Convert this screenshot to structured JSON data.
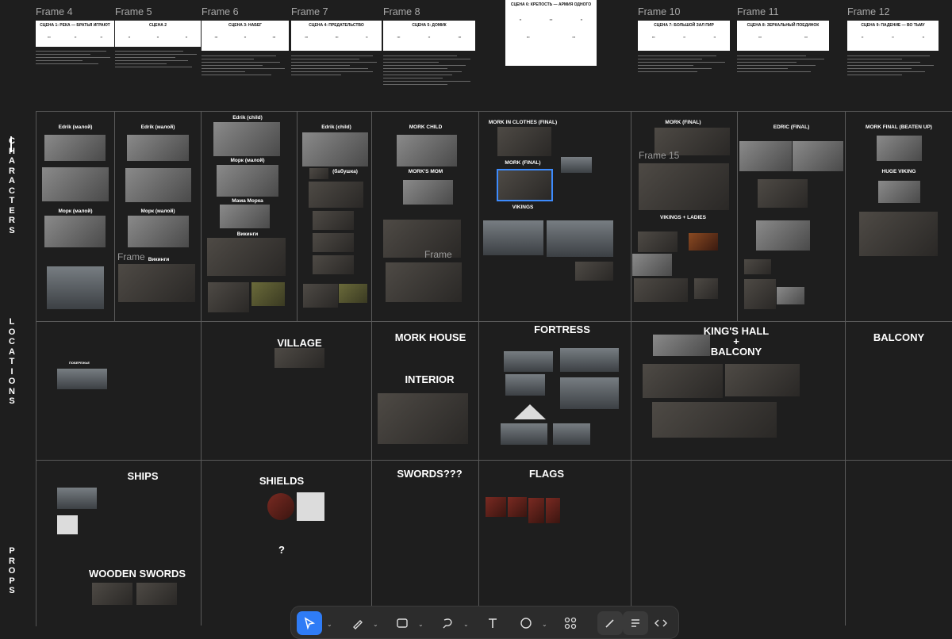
{
  "frames": {
    "frame4": "Frame 4",
    "frame5": "Frame 5",
    "frame6": "Frame 6",
    "frame7": "Frame 7",
    "frame8": "Frame 8",
    "frame10": "Frame 10",
    "frame11": "Frame 11",
    "frame12": "Frame 12",
    "frame15": "Frame 15",
    "frame_partial": "Frame"
  },
  "docs": {
    "d4": "СЦЕНА 1: РЕКА — БРАТЬЯ ИГРАЮТ",
    "d5": "СЦЕНА 2",
    "d6": "СЦЕНА 3: НАБЕГ",
    "d7": "СЦЕНА 4: ПРЕДАТЕЛЬСТВО",
    "d8": "СЦЕНА 5: ДОМИК",
    "d9": "СЦЕНА 6: КРЕПОСТЬ — АРМИЯ ОДНОГО",
    "d10": "СЦЕНА 7: БОЛЬШОЙ ЗАЛ ПИР",
    "d11": "СЦЕНА 8: ЗЕРКАЛЬНЫЙ ПОЕДИНОК",
    "d12": "СЦЕНА 9: ПАДЕНИЕ — ВО ТЬМУ"
  },
  "rows": {
    "characters": "CHARACTERS",
    "locations": "LOCATIONS",
    "props": "PROPS"
  },
  "characters": {
    "c1a": "Edrik (малой)",
    "c1b": "Морк (малой)",
    "c2a": "Edrik (малой)",
    "c2b": "Морк (малой)",
    "c2c": "Викинги",
    "c3a": "Edrik (child)",
    "c3b": "Морк (малой)",
    "c3c": "Мама Морка",
    "c3d": "Викинги",
    "c4a": "Edrik (child)",
    "c4b": "(бабушка)",
    "c5a": "MORK CHILD",
    "c5b": "MORK'S MOM",
    "c6a": "MORK IN CLOTHES (FINAL)",
    "c6b": "MORK (FINAL)",
    "c6c": "VIKINGS",
    "c7a": "MORK (FINAL)",
    "c7b": "VIKINGS + LADIES",
    "c8a": "EDRIC (FINAL)",
    "c9a": "MORK FINAL (BEATEN UP)",
    "c9b": "HUGE VIKING"
  },
  "locations": {
    "l1": "ПОБЕРЕЖЬЕ",
    "l2": "VILLAGE",
    "l3a": "MORK HOUSE",
    "l3b": "INTERIOR",
    "l4": "FORTRESS",
    "l5": "KING'S HALL\n+\nBALCONY",
    "l6": "BALCONY"
  },
  "props": {
    "p1": "SHIPS",
    "p2": "WOODEN SWORDS",
    "p3": "SHIELDS",
    "p4": "?",
    "p5": "SWORDS???",
    "p6": "FLAGS"
  },
  "toolbar": {
    "tools": [
      "pointer-tool",
      "pen-tool",
      "rectangle-tool",
      "lasso-tool",
      "text-tool",
      "shape-tool",
      "components-tool",
      "pencil-tool",
      "layers-tool",
      "code-tool"
    ],
    "active": "pointer-tool"
  },
  "colors": {
    "background": "#1e1e1e",
    "accent": "#2f7cf6",
    "grid_line": "#5a5a5a"
  }
}
